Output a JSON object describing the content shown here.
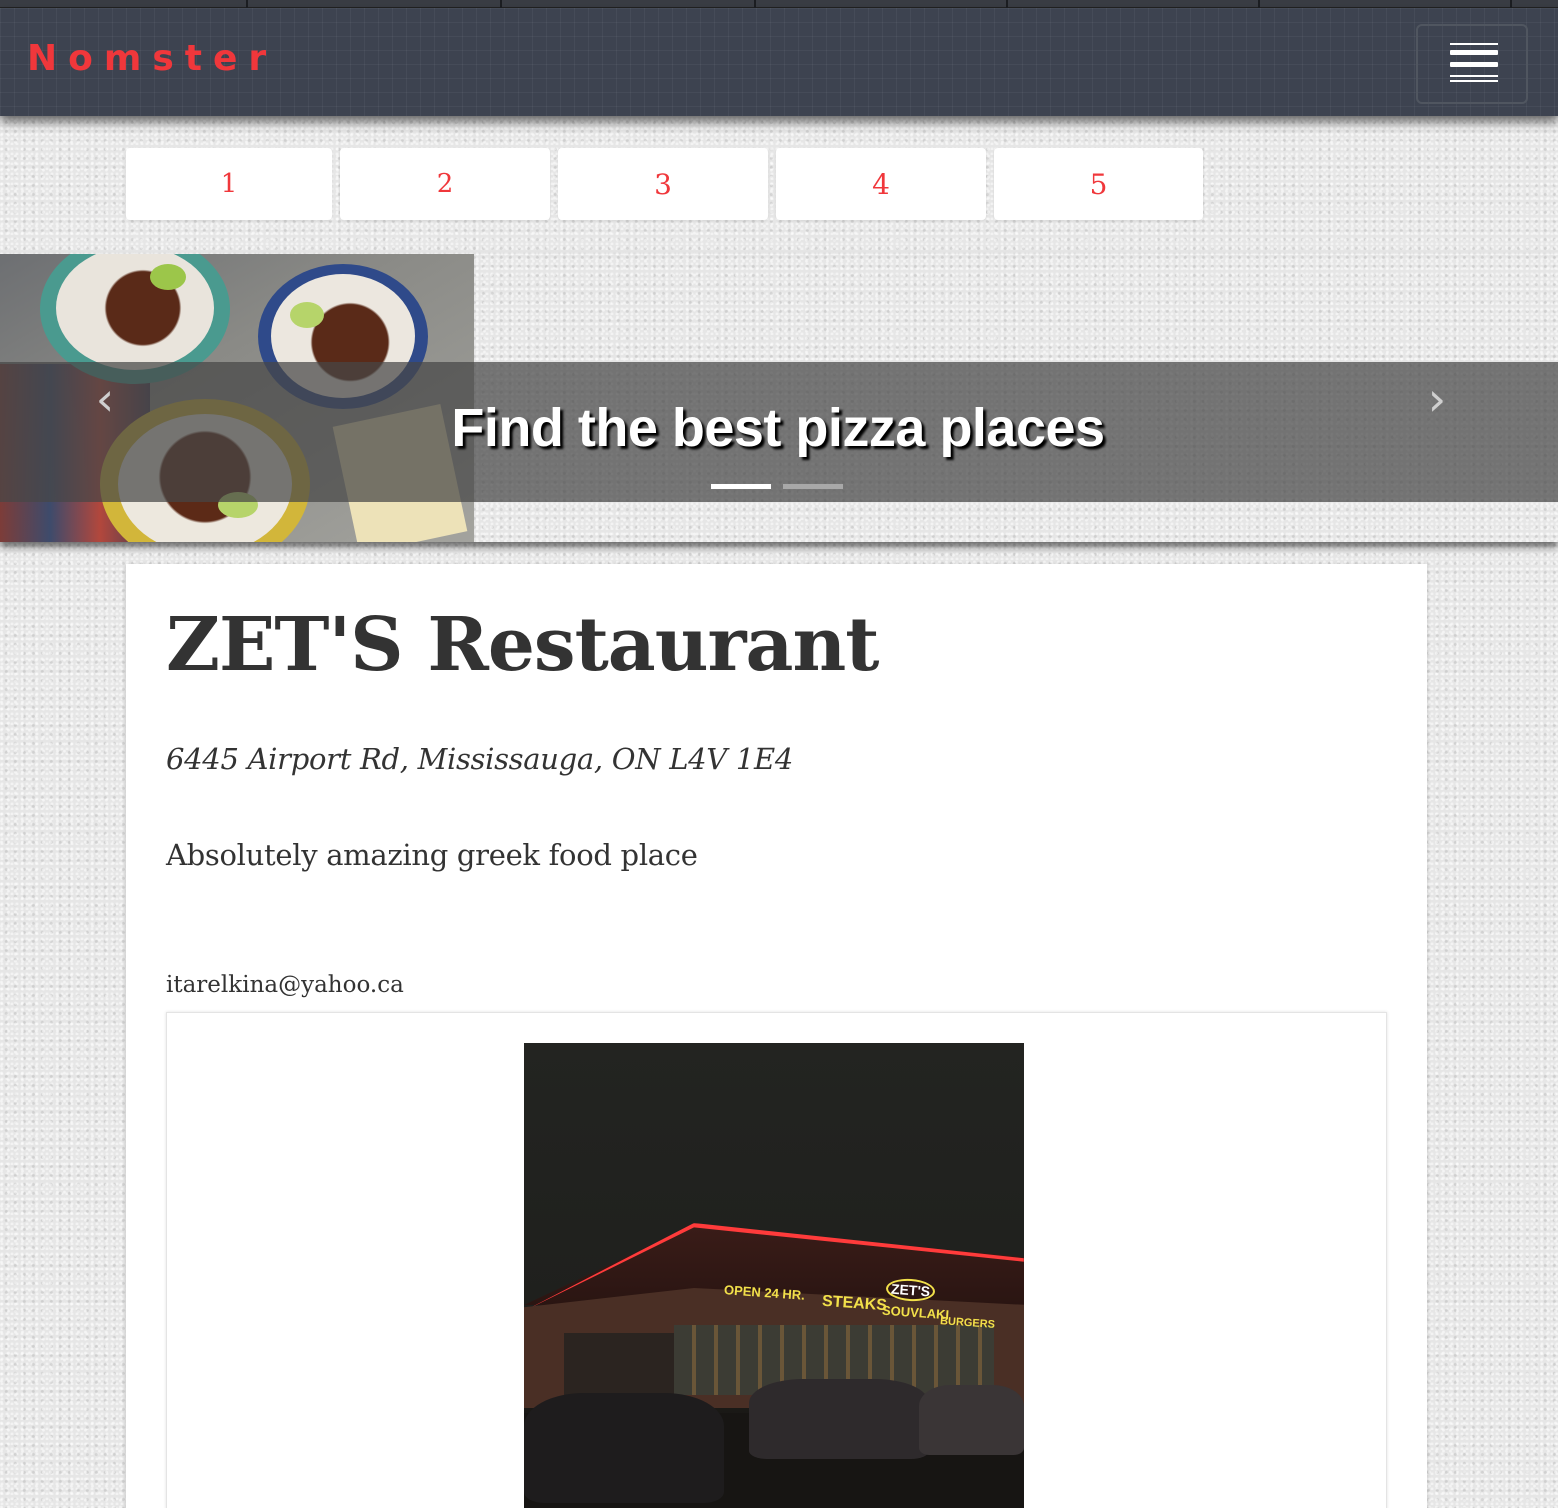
{
  "brand": {
    "name": "Nomster"
  },
  "navbar": {
    "menu_toggle_icon": "hamburger-menu-icon"
  },
  "pagination": {
    "pages": [
      "1",
      "2",
      "3",
      "4",
      "5"
    ]
  },
  "carousel": {
    "caption": "Find the best pizza places",
    "prev_icon": "chevron-left-icon",
    "next_icon": "chevron-right-icon",
    "slide_count": 2,
    "active_slide": 1
  },
  "place": {
    "name": "ZET'S Restaurant",
    "address": "6445 Airport Rd, Mississauga, ON L4V 1E4",
    "description": "Absolutely amazing greek food place",
    "email": "itarelkina@yahoo.ca",
    "photo_signs": [
      "OPEN 24 HR.",
      "STEAKS",
      "ZET'S",
      "SOUVLAKI",
      "BURGERS"
    ]
  },
  "colors": {
    "brand_red": "#f0373b",
    "navbar_bg": "#3d4350",
    "caption_band": "#464646"
  }
}
